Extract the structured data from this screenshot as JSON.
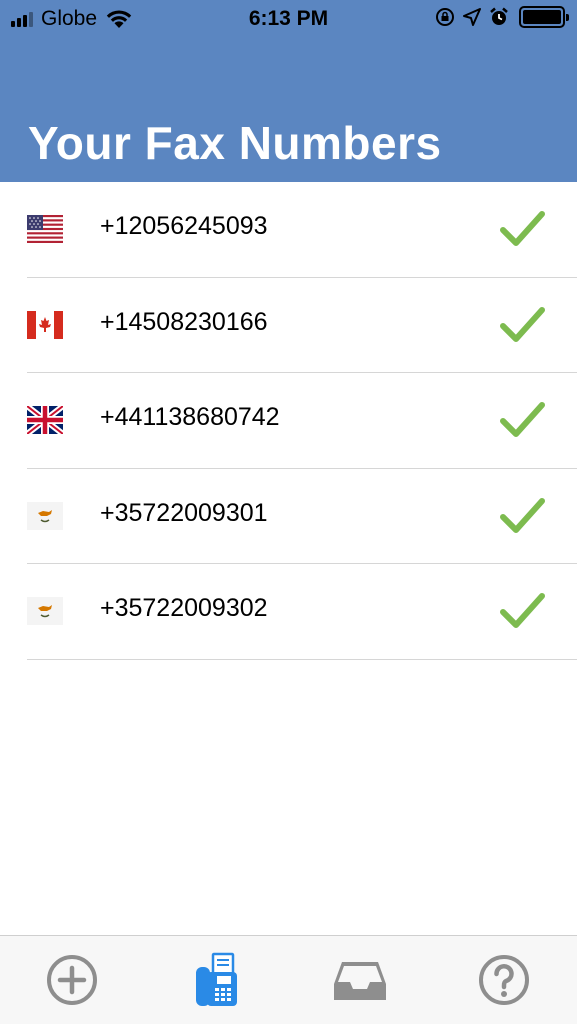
{
  "status_bar": {
    "carrier": "Globe",
    "time": "6:13 PM"
  },
  "header": {
    "title": "Your Fax Numbers",
    "background_color": "#5b86c1"
  },
  "fax_numbers": [
    {
      "flag": "us-flag-icon",
      "number": "+12056245093",
      "status": "check-icon"
    },
    {
      "flag": "canada-flag-icon",
      "number": "+14508230166",
      "status": "check-icon"
    },
    {
      "flag": "uk-flag-icon",
      "number": "+441138680742",
      "status": "check-icon"
    },
    {
      "flag": "cyprus-flag-icon",
      "number": "+35722009301",
      "status": "check-icon"
    },
    {
      "flag": "cyprus-flag-icon",
      "number": "+35722009302",
      "status": "check-icon"
    }
  ],
  "tab_bar": {
    "tabs": [
      {
        "icon": "add-circle-icon",
        "active": false
      },
      {
        "icon": "fax-machine-icon",
        "active": true
      },
      {
        "icon": "inbox-tray-icon",
        "active": false
      },
      {
        "icon": "help-circle-icon",
        "active": false
      }
    ],
    "active_color": "#2a8ae6",
    "inactive_color": "#8e8e8e"
  },
  "check_color": "#7dbb4f"
}
